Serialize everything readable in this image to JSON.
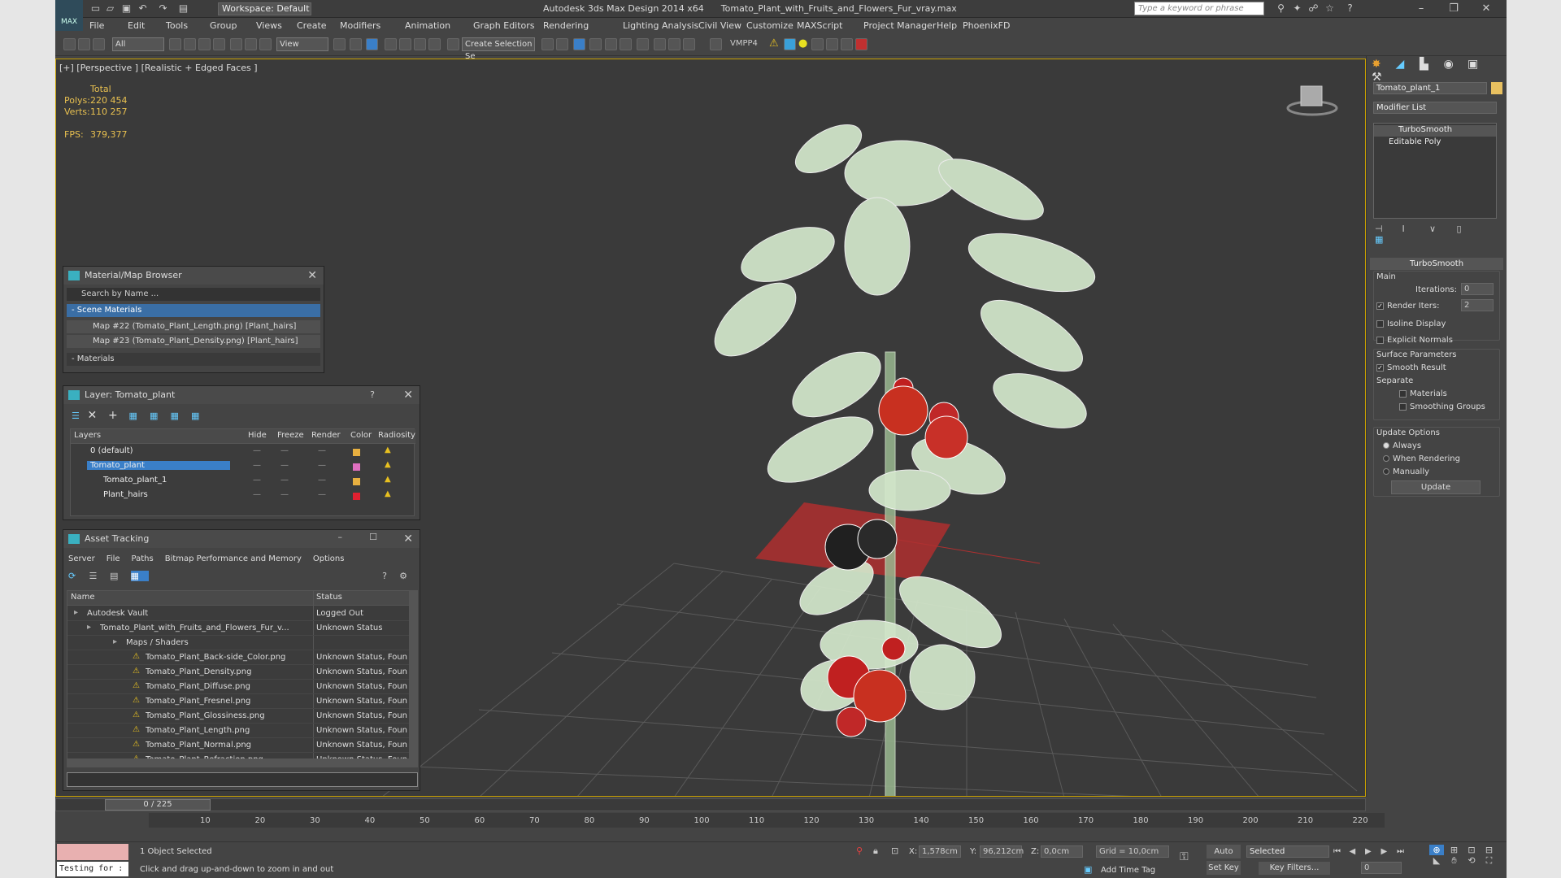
{
  "window": {
    "app_title": "Autodesk 3ds Max Design 2014 x64",
    "file_name": "Tomato_Plant_with_Fruits_and_Flowers_Fur_vray.max",
    "workspace": "Workspace: Default",
    "search_placeholder": "Type a keyword or phrase",
    "logo_text": "MAX"
  },
  "menu": [
    "File",
    "Edit",
    "Tools",
    "Group",
    "Views",
    "Create",
    "Modifiers",
    "Animation",
    "Graph Editors",
    "Rendering",
    "Lighting Analysis",
    "Civil View",
    "Customize",
    "MAXScript",
    "Project Manager",
    "Help",
    "PhoenixFD"
  ],
  "toolbar": {
    "filter": "All",
    "coord": "View",
    "selection_set": "Create Selection Se",
    "vmpp": "VMPP4"
  },
  "viewport": {
    "label": "[+] [Perspective ] [Realistic + Edged Faces ]",
    "stats_header": "Total",
    "polys_label": "Polys:",
    "polys_value": "220 454",
    "verts_label": "Verts:",
    "verts_value": "110 257",
    "fps_label": "FPS:",
    "fps_value": "379,377"
  },
  "material_browser": {
    "title": "Material/Map Browser",
    "search_placeholder": "Search by Name ...",
    "scene_materials": "- Scene Materials",
    "items": [
      "Map #22 (Tomato_Plant_Length.png)  [Plant_hairs]",
      "Map #23 (Tomato_Plant_Density.png)  [Plant_hairs]"
    ],
    "materials_section": "- Materials"
  },
  "layer_panel": {
    "title": "Layer: Tomato_plant",
    "help": "?",
    "columns": [
      "Layers",
      "Hide",
      "Freeze",
      "Render",
      "Color",
      "Radiosity"
    ],
    "rows": [
      {
        "name": "0 (default)",
        "color": "#e8b040"
      },
      {
        "name": "Tomato_plant",
        "color": "#e070c0"
      },
      {
        "name": "Tomato_plant_1",
        "color": "#e8b040"
      },
      {
        "name": "Plant_hairs",
        "color": "#e02030"
      }
    ]
  },
  "asset_tracking": {
    "title": "Asset Tracking",
    "menu": [
      "Server",
      "File",
      "Paths",
      "Bitmap Performance and Memory",
      "Options"
    ],
    "columns": [
      "Name",
      "Status"
    ],
    "rows": [
      {
        "name": "Autodesk Vault",
        "status": "Logged Out"
      },
      {
        "name": "Tomato_Plant_with_Fruits_and_Flowers_Fur_v...",
        "status": "Unknown Status"
      },
      {
        "name": "Maps / Shaders",
        "status": ""
      },
      {
        "name": "Tomato_Plant_Back-side_Color.png",
        "status": "Unknown Status, Foun"
      },
      {
        "name": "Tomato_Plant_Density.png",
        "status": "Unknown Status, Foun"
      },
      {
        "name": "Tomato_Plant_Diffuse.png",
        "status": "Unknown Status, Foun"
      },
      {
        "name": "Tomato_Plant_Fresnel.png",
        "status": "Unknown Status, Foun"
      },
      {
        "name": "Tomato_Plant_Glossiness.png",
        "status": "Unknown Status, Foun"
      },
      {
        "name": "Tomato_Plant_Length.png",
        "status": "Unknown Status, Foun"
      },
      {
        "name": "Tomato_Plant_Normal.png",
        "status": "Unknown Status, Foun"
      },
      {
        "name": "Tomato_Plant_Refraction.png",
        "status": "Unknown Status, Foun"
      }
    ]
  },
  "command_panel": {
    "object_name": "Tomato_plant_1",
    "modifier_list": "Modifier List",
    "stack": [
      "TurboSmooth",
      "Editable Poly"
    ],
    "rollout_title": "TurboSmooth",
    "main_label": "Main",
    "iterations_label": "Iterations:",
    "iterations_value": "0",
    "render_iters_label": "Render Iters:",
    "render_iters_value": "2",
    "isoline": "Isoline Display",
    "explicit_normals": "Explicit Normals",
    "surface_params": "Surface Parameters",
    "smooth_result": "Smooth Result",
    "separate": "Separate",
    "materials": "Materials",
    "smoothing_groups": "Smoothing Groups",
    "update_options": "Update Options",
    "always": "Always",
    "when_rendering": "When Rendering",
    "manually": "Manually",
    "update_btn": "Update"
  },
  "timeline": {
    "frame": "0 / 225",
    "ticks": [
      "10",
      "20",
      "30",
      "40",
      "50",
      "60",
      "70",
      "80",
      "90",
      "100",
      "110",
      "120",
      "130",
      "140",
      "150",
      "160",
      "170",
      "180",
      "190",
      "200",
      "210",
      "220"
    ]
  },
  "status": {
    "selected": "1 Object Selected",
    "prompt": "Click and drag up-and-down to zoom in and out",
    "script": "Testing for :",
    "x_label": "X:",
    "x_value": "1,578cm",
    "y_label": "Y:",
    "y_value": "96,212cm",
    "z_label": "Z:",
    "z_value": "0,0cm",
    "grid": "Grid = 10,0cm",
    "add_time_tag": "Add Time Tag",
    "auto_key": "Auto Key",
    "set_key": "Set Key",
    "selected_dd": "Selected",
    "key_filters": "Key Filters...",
    "frame_value": "0"
  }
}
